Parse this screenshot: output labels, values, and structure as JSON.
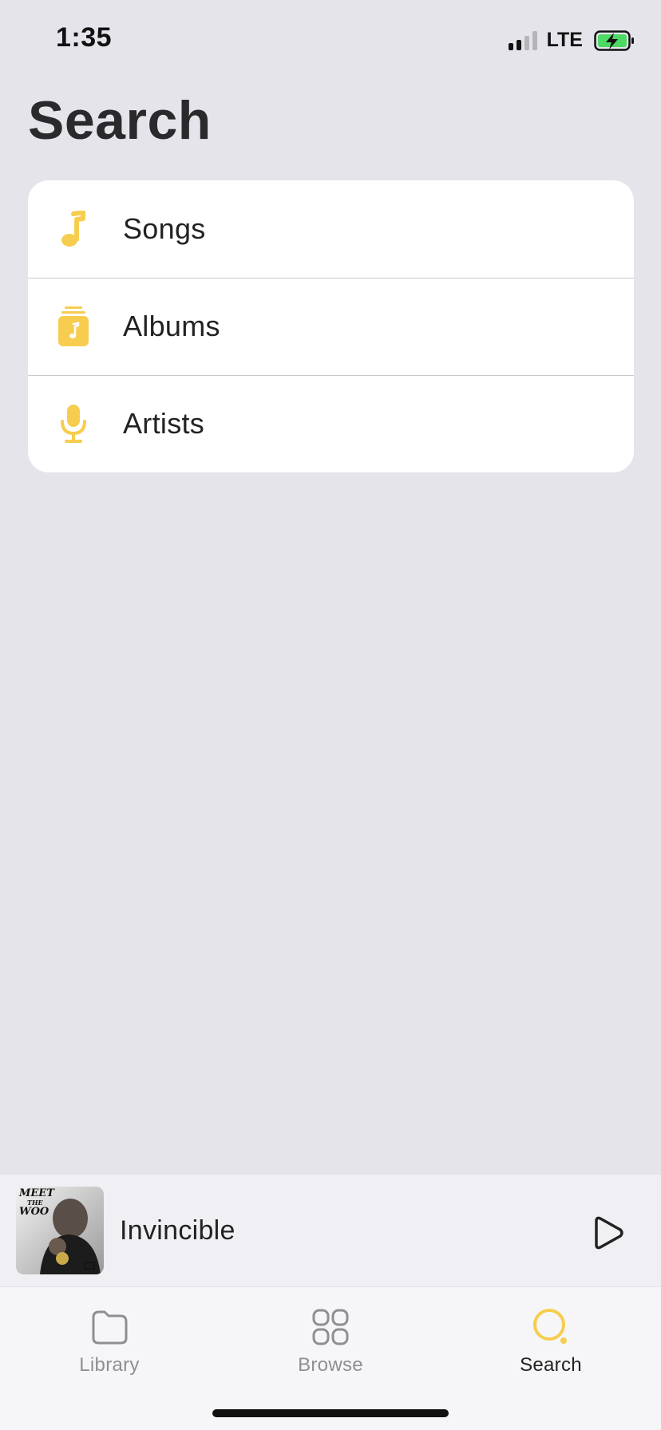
{
  "status_bar": {
    "time": "1:35",
    "network": "LTE"
  },
  "page": {
    "title": "Search"
  },
  "categories": [
    {
      "label": "Songs",
      "icon": "music-note-icon"
    },
    {
      "label": "Albums",
      "icon": "album-stack-icon"
    },
    {
      "label": "Artists",
      "icon": "microphone-icon"
    }
  ],
  "mini_player": {
    "track_title": "Invincible",
    "album_art_text": [
      "MEET",
      "THE",
      "WOO"
    ]
  },
  "tabs": [
    {
      "label": "Library",
      "icon": "folder-icon",
      "active": false
    },
    {
      "label": "Browse",
      "icon": "grid-icon",
      "active": false
    },
    {
      "label": "Search",
      "icon": "search-icon",
      "active": true
    }
  ],
  "colors": {
    "accent": "#f7cd4f",
    "background": "#e5e4ea",
    "card": "#ffffff",
    "inactive_tab": "#8e8e93"
  }
}
